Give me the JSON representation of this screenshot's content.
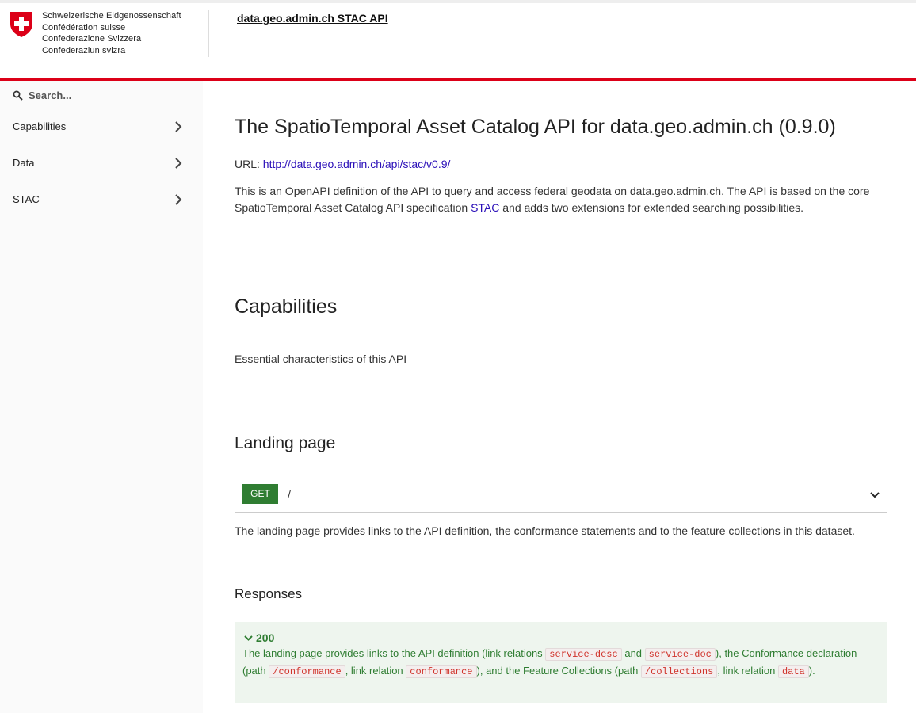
{
  "header": {
    "confederation_lines": [
      "Schweizerische Eidgenossenschaft",
      "Confédération suisse",
      "Confederazione Svizzera",
      "Confederaziun svizra"
    ],
    "site_title": "data.geo.admin.ch STAC API",
    "brand_red": "#dc0018"
  },
  "sidebar": {
    "search_placeholder": "Search...",
    "items": [
      {
        "label": "Capabilities"
      },
      {
        "label": "Data"
      },
      {
        "label": "STAC"
      }
    ]
  },
  "main": {
    "title": "The SpatioTemporal Asset Catalog API for data.geo.admin.ch (0.9.0)",
    "url_label": "URL:",
    "url": "http://data.geo.admin.ch/api/stac/v0.9/",
    "intro_part1": "This is an OpenAPI definition of the API to query and access federal geodata on data.geo.admin.ch. The API is based on the core SpatioTemporal Asset Catalog API specification",
    "intro_link": "STAC",
    "intro_part2": "and adds two extensions for extended searching possibilities.",
    "capabilities_heading": "Capabilities",
    "capabilities_desc": "Essential characteristics of this API",
    "landing_heading": "Landing page",
    "operation": {
      "method": "GET",
      "path": "/",
      "method_color": "#2f7d32"
    },
    "landing_desc": "The landing page provides links to the API definition, the conformance statements and to the feature collections in this dataset.",
    "responses_heading": "Responses",
    "response": {
      "code": "200",
      "t1": "The landing page provides links to the API definition (link relations",
      "c1": "service-desc",
      "t2": "and",
      "c2": "service-doc",
      "t3": "), the Conformance declaration (path",
      "c3": "/conformance",
      "t4": ", link relation",
      "c4": "conformance",
      "t5": "), and the Feature Collections (path",
      "c5": "/collections",
      "t6": ", link relation",
      "c6": "data",
      "t7": ")."
    }
  }
}
